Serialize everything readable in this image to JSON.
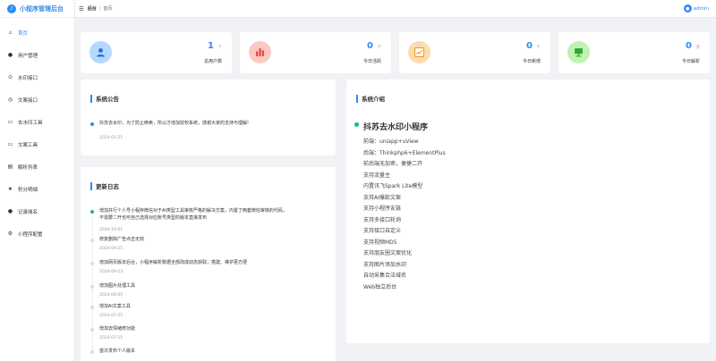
{
  "brand": {
    "title": "小程序管理后台",
    "logo_icon": "logo-icon"
  },
  "sidebar": {
    "items": [
      {
        "label": "首页",
        "icon": "home-icon",
        "glyph": "⌂",
        "active": true
      },
      {
        "label": "用户管理",
        "icon": "user-icon",
        "glyph": "●"
      },
      {
        "label": "水印接口",
        "icon": "api-icon",
        "glyph": "⊙"
      },
      {
        "label": "文案接口",
        "icon": "document-icon",
        "glyph": "◎"
      },
      {
        "label": "去水印工具",
        "icon": "tool-icon",
        "glyph": "▭"
      },
      {
        "label": "文案工具",
        "icon": "copy-icon",
        "glyph": "▭"
      },
      {
        "label": "解析列表",
        "icon": "list-icon",
        "glyph": "▤"
      },
      {
        "label": "积分明细",
        "icon": "star-icon",
        "glyph": "★"
      },
      {
        "label": "记录域名",
        "icon": "domain-icon",
        "glyph": "●"
      },
      {
        "label": "小程序配置",
        "icon": "settings-icon",
        "glyph": "⚙"
      }
    ]
  },
  "topbar": {
    "crumb_root": "后台",
    "crumb_sep": "/",
    "crumb_current": "首页",
    "user": "admin"
  },
  "stats": [
    {
      "value": "1",
      "unit": "个",
      "label": "总用户数",
      "icon": "user-icon",
      "bg": "#b5d8ff",
      "fg": "#2d6bd6"
    },
    {
      "value": "0",
      "unit": "个",
      "label": "今日活跃",
      "icon": "bar-chart-icon",
      "bg": "#fcc8c3",
      "fg": "#e8453c"
    },
    {
      "value": "0",
      "unit": "个",
      "label": "今日新增",
      "icon": "trend-icon",
      "bg": "#fbdcae",
      "fg": "#f09a2c"
    },
    {
      "value": "0",
      "unit": "次",
      "label": "今日解析",
      "icon": "monitor-icon",
      "bg": "#bff3b2",
      "fg": "#2fa82f"
    }
  ],
  "announcement": {
    "title": "系统公告",
    "text": "抖苏去水印，为了防止倒卖，所以才增加授权系统，感谢大家的支持与理解!",
    "date": "2024-05-25",
    "dot_color": "#2d8cf0"
  },
  "changelog": {
    "title": "更新日志",
    "items": [
      {
        "text": "增加并行个人号小程序微信对于AI类型工具审核严格的解决方案，内置了两套微信审核的代码，不需要二开也可自己选择对应账号类型的版本直接发布",
        "date": "2024-10-01",
        "dot_color": "#19be6b"
      },
      {
        "text": "修复删除广告点击无效",
        "date": "2024-09-25"
      },
      {
        "text": "增加网页版本后台，小程序解析数据全部改成动态获取，搭建、维护更方便",
        "date": "2024-09-23"
      },
      {
        "text": "增加图片处理工具",
        "date": "2024-08-05"
      },
      {
        "text": "增加AI文案工具",
        "date": "2024-07-25"
      },
      {
        "text": "增加去情绪修功能",
        "date": "2024-07-15"
      },
      {
        "text": "首次发布个人版本",
        "date": ""
      }
    ]
  },
  "intro": {
    "title": "系统介绍",
    "name": "抖苏去水印小程序",
    "lines": [
      "前端：uniapp+uView",
      "后端：Thinkphp6+ElementPlus",
      "前后端无加密，便捷二开",
      "支持流量主",
      "内置讯飞Spark Lite模型",
      "支持AI爆款文案",
      "支持小程序友链",
      "支持多接口轮询",
      "支持接口自定义",
      "支持视频MD5",
      "支持朋友圈文案优化",
      "支持图片添加水印",
      "自动采集合法域名",
      "Web独立后台"
    ]
  }
}
